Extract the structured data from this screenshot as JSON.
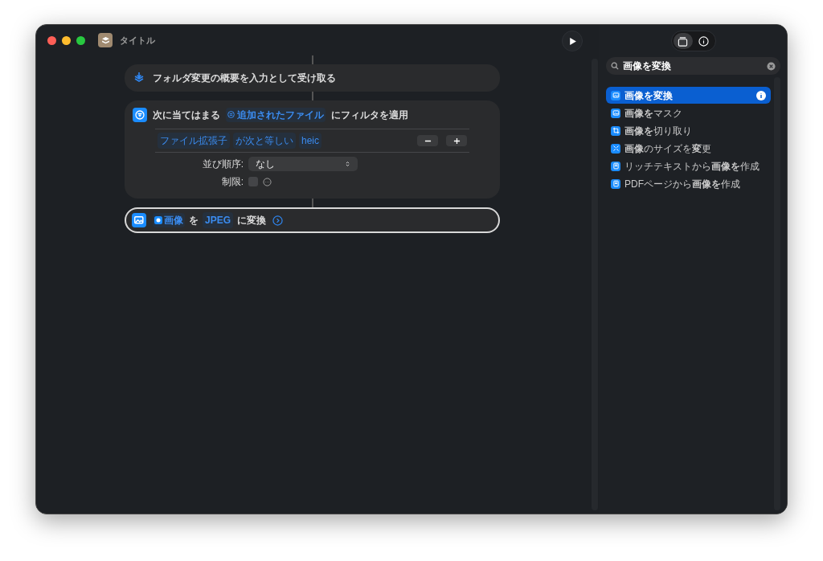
{
  "window": {
    "title": "タイトル"
  },
  "actions": [
    {
      "kind": "receive",
      "selected": false,
      "text": "フォルダ変更の概要を入力として受け取る"
    },
    {
      "kind": "filter",
      "selected": false,
      "prefix": "次に当てはまる",
      "variable": "追加されたファイル",
      "suffix": "にフィルタを適用",
      "condition": [
        "ファイル拡張子",
        "が次と等しい",
        "heic"
      ],
      "sort_label": "並び順序:",
      "sort_value": "なし",
      "limit_label": "制限:",
      "limit_checked": false
    },
    {
      "kind": "convert",
      "selected": true,
      "variable": "画像",
      "joiner": "を",
      "format": "JPEG",
      "suffix": "に変換"
    }
  ],
  "sidebar": {
    "tabs": [
      {
        "kind": "library",
        "selected": true
      },
      {
        "kind": "info",
        "selected": false
      }
    ],
    "search": {
      "value": "画像を変換"
    },
    "results": [
      {
        "kind": "image",
        "label": "**画像を変換**",
        "selected": true
      },
      {
        "kind": "image",
        "label": "**画像を**マスク",
        "selected": false
      },
      {
        "kind": "crop",
        "label": "**画像を**切り取り",
        "selected": false
      },
      {
        "kind": "resize",
        "label": "**画像**のサイズを**変**更",
        "selected": false
      },
      {
        "kind": "doc",
        "label": "リッチテキストから**画像を**作成",
        "selected": false
      },
      {
        "kind": "doc",
        "label": "PDFページから**画像を**作成",
        "selected": false
      }
    ]
  }
}
